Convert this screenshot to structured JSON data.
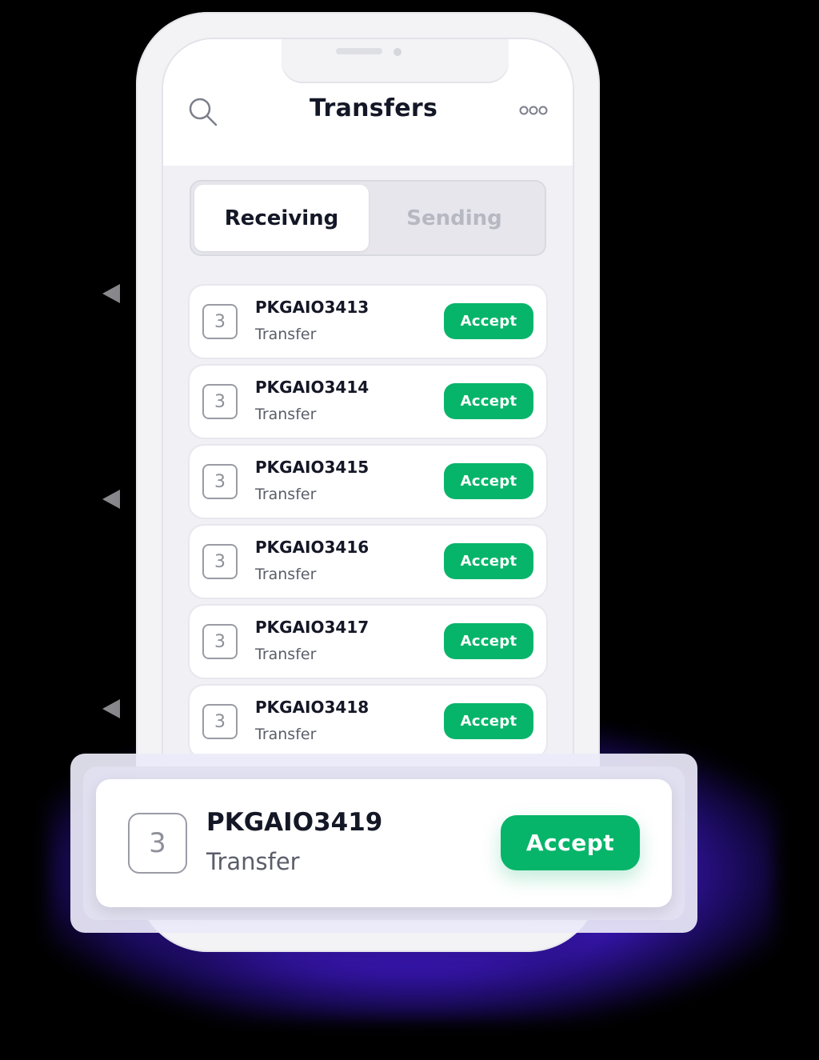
{
  "header": {
    "title": "Transfers"
  },
  "icons": {
    "search": "search-icon",
    "more": "more-icon"
  },
  "tabs": [
    {
      "label": "Receiving",
      "active": true
    },
    {
      "label": "Sending",
      "active": false
    }
  ],
  "transfers": [
    {
      "badge": "3",
      "id": "PKGAIO3413",
      "type": "Transfer",
      "action": "Accept"
    },
    {
      "badge": "3",
      "id": "PKGAIO3414",
      "type": "Transfer",
      "action": "Accept"
    },
    {
      "badge": "3",
      "id": "PKGAIO3415",
      "type": "Transfer",
      "action": "Accept"
    },
    {
      "badge": "3",
      "id": "PKGAIO3416",
      "type": "Transfer",
      "action": "Accept"
    },
    {
      "badge": "3",
      "id": "PKGAIO3417",
      "type": "Transfer",
      "action": "Accept"
    },
    {
      "badge": "3",
      "id": "PKGAIO3418",
      "type": "Transfer",
      "action": "Accept"
    }
  ],
  "highlight": {
    "badge": "3",
    "id": "PKGAIO3419",
    "type": "Transfer",
    "action": "Accept"
  },
  "colors": {
    "accent": "#07b56a",
    "glow": "#4b1fd6",
    "text": "#141726"
  }
}
